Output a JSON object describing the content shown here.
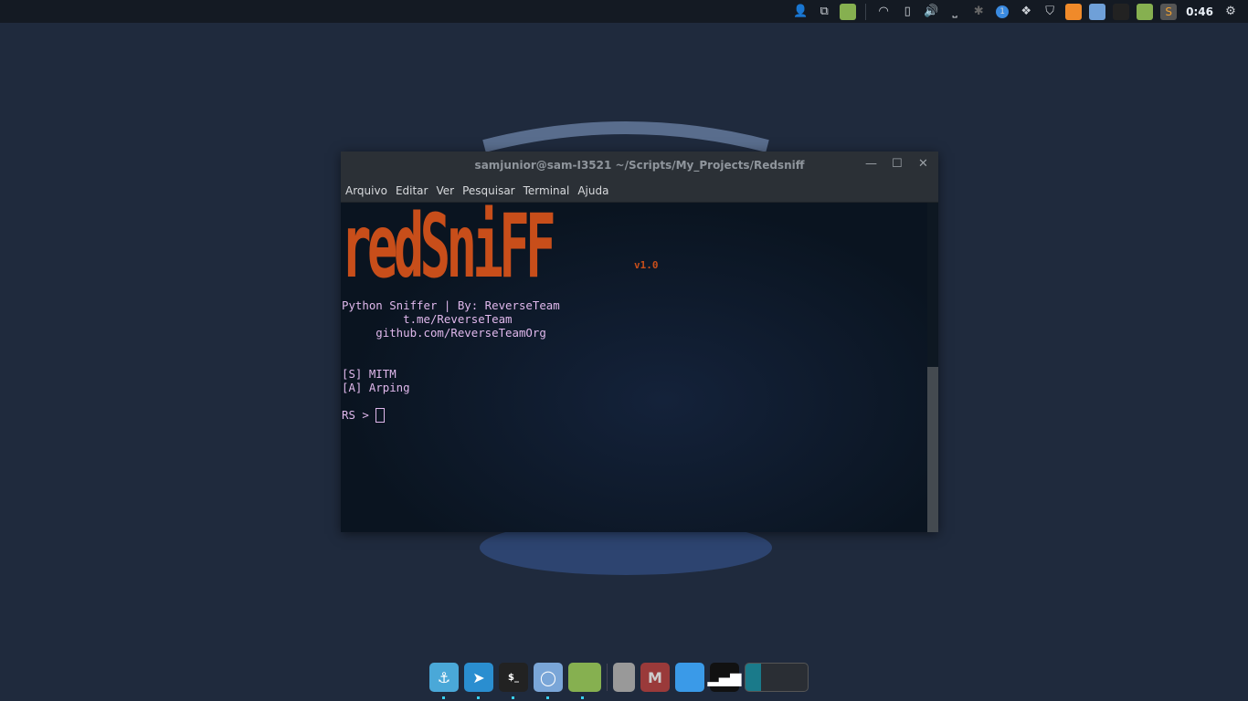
{
  "topbar": {
    "clock": "0:46",
    "icons": [
      "user-icon",
      "windows-icon",
      "folder-app-icon",
      "wifi-icon",
      "battery-icon",
      "volume-icon",
      "keyboard-layout-icon",
      "bluetooth-icon",
      "notification-badge-icon",
      "dropbox-icon",
      "shield-icon",
      "firefox-icon",
      "chromium-icon",
      "terminal-icon",
      "files-icon",
      "sublime-icon",
      "settings-gear-icon"
    ],
    "notification_count": "1"
  },
  "window": {
    "title": "samjunior@sam-I3521 ~/Scripts/My_Projects/Redsniff",
    "menu": [
      "Arquivo",
      "Editar",
      "Ver",
      "Pesquisar",
      "Terminal",
      "Ajuda"
    ]
  },
  "terminal": {
    "logo": "redSniFF",
    "version": "v1.0",
    "lines": [
      "Python Sniffer | By: ReverseTeam",
      "         t.me/ReverseTeam",
      "     github.com/ReverseTeamOrg",
      "",
      "",
      "[S] MITM",
      "[A] Arping",
      "",
      "RS > "
    ],
    "scroll_position_percent": 50
  },
  "dock": {
    "items": [
      "anchor-icon",
      "telegram-icon",
      "terminal-icon",
      "chromium-icon",
      "files-icon",
      "trash-icon",
      "mailspring-icon",
      "desktop-icon",
      "signal-stats-icon",
      "workspace-switcher-icon"
    ],
    "colors": {
      "accent": "#c84e1a",
      "text": "#e0b8ec"
    }
  }
}
